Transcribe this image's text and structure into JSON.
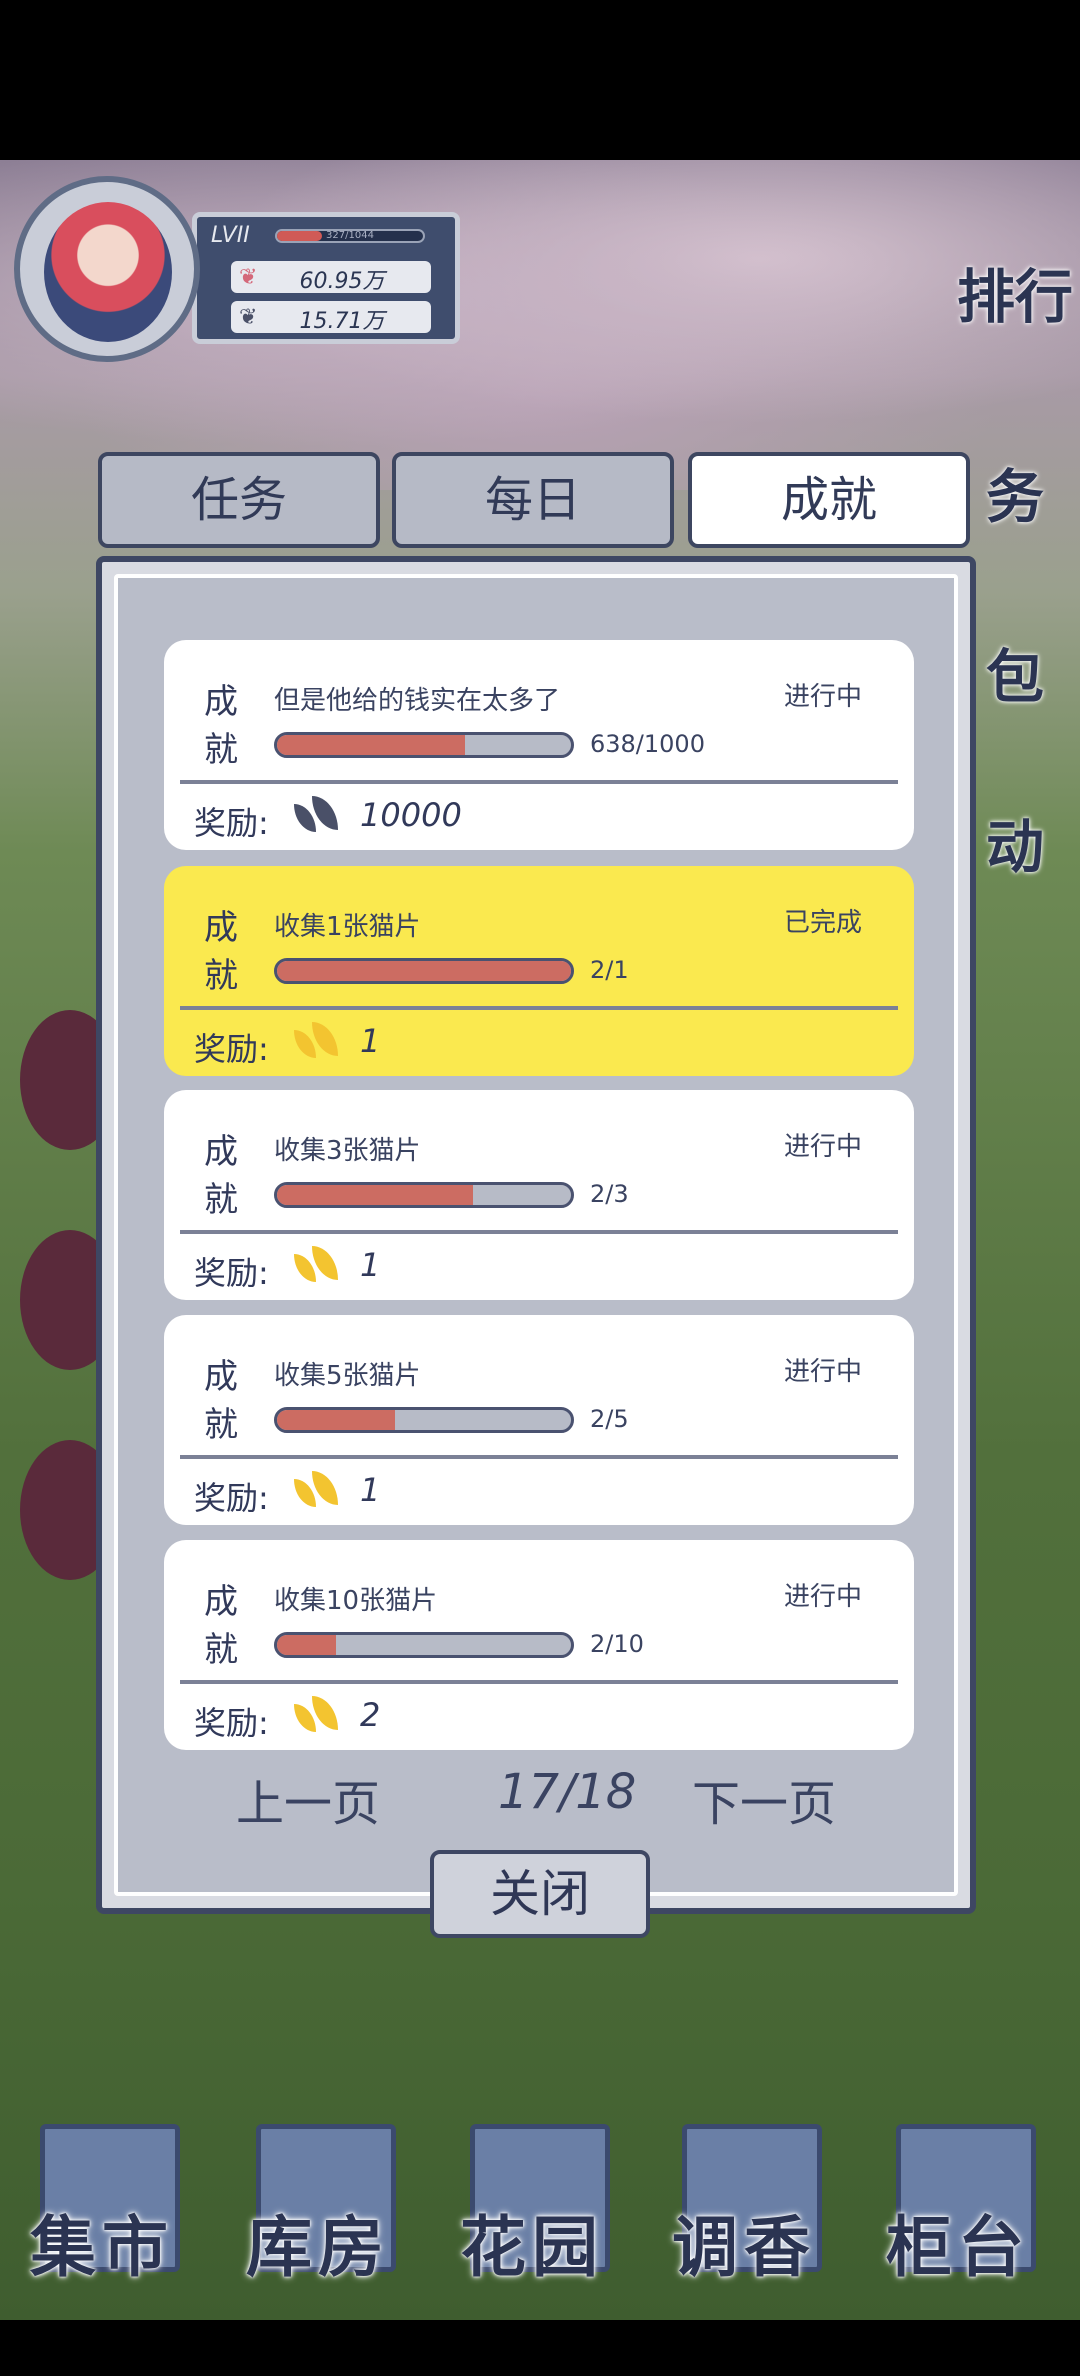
{
  "player": {
    "level": "LVII",
    "exp_text": "327/1044",
    "exp_progress": 0.31,
    "currencies": [
      {
        "icon": "pink-petal-icon",
        "value": "60.95万"
      },
      {
        "icon": "dark-leaf-icon",
        "value": "15.71万"
      }
    ]
  },
  "side_menu": {
    "ranking": "排行",
    "task": "务",
    "bag": "包",
    "event": "动"
  },
  "tabs": [
    {
      "label": "任务",
      "active": false
    },
    {
      "label": "每日",
      "active": false
    },
    {
      "label": "成就",
      "active": true
    }
  ],
  "achievements": [
    {
      "kind": "成就",
      "title": "但是他给的钱实在太多了",
      "status": "进行中",
      "progress_text": "638/1000",
      "progress": 0.638,
      "reward_label": "奖励:",
      "reward_icon": "dark-leaf-icon",
      "reward_amount": "10000",
      "completed": false
    },
    {
      "kind": "成就",
      "title": "收集1张猫片",
      "status": "已完成",
      "progress_text": "2/1",
      "progress": 1.0,
      "reward_label": "奖励:",
      "reward_icon": "gold-leaf-icon",
      "reward_amount": "1",
      "completed": true
    },
    {
      "kind": "成就",
      "title": "收集3张猫片",
      "status": "进行中",
      "progress_text": "2/3",
      "progress": 0.667,
      "reward_label": "奖励:",
      "reward_icon": "gold-leaf-icon",
      "reward_amount": "1",
      "completed": false
    },
    {
      "kind": "成就",
      "title": "收集5张猫片",
      "status": "进行中",
      "progress_text": "2/5",
      "progress": 0.4,
      "reward_label": "奖励:",
      "reward_icon": "gold-leaf-icon",
      "reward_amount": "1",
      "completed": false
    },
    {
      "kind": "成就",
      "title": "收集10张猫片",
      "status": "进行中",
      "progress_text": "2/10",
      "progress": 0.2,
      "reward_label": "奖励:",
      "reward_icon": "gold-leaf-icon",
      "reward_amount": "2",
      "completed": false
    }
  ],
  "pager": {
    "prev": "上一页",
    "page": "17/18",
    "next": "下一页"
  },
  "close_label": "关闭",
  "bottom_nav": [
    {
      "label": "集市",
      "icon": "pavilion-icon"
    },
    {
      "label": "库房",
      "icon": "house-icon"
    },
    {
      "label": "花园",
      "icon": "rose-icon"
    },
    {
      "label": "调香",
      "icon": "perfume-bottle-icon"
    },
    {
      "label": "柜台",
      "icon": "counter-icon"
    }
  ],
  "colors": {
    "panel_border": "#3e4763",
    "completed_card": "#fae94f",
    "progress_fill": "#cc6c62",
    "reward_gold": "#f3c430"
  }
}
